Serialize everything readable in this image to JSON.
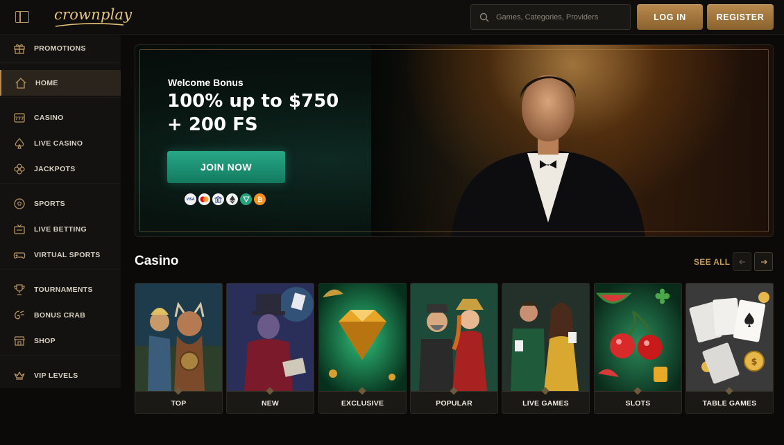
{
  "header": {
    "logo_text": "crownplay",
    "search_placeholder": "Games, Categories, Providers",
    "login_label": "LOG IN",
    "register_label": "REGISTER"
  },
  "sidebar": {
    "items": [
      {
        "label": "PROMOTIONS",
        "icon": "gift-icon"
      },
      {
        "label": "HOME",
        "icon": "home-icon",
        "active": true
      },
      {
        "label": "CASINO",
        "icon": "slot-777-icon"
      },
      {
        "label": "LIVE CASINO",
        "icon": "spade-icon"
      },
      {
        "label": "JACKPOTS",
        "icon": "clover-icon"
      },
      {
        "label": "SPORTS",
        "icon": "soccer-ball-icon"
      },
      {
        "label": "LIVE BETTING",
        "icon": "live-tv-icon"
      },
      {
        "label": "VIRTUAL SPORTS",
        "icon": "gamepad-icon"
      },
      {
        "label": "TOURNAMENTS",
        "icon": "trophy-icon"
      },
      {
        "label": "BONUS CRAB",
        "icon": "claw-icon"
      },
      {
        "label": "SHOP",
        "icon": "shop-icon"
      },
      {
        "label": "VIP LEVELS",
        "icon": "crown-icon"
      }
    ]
  },
  "banner": {
    "eyebrow": "Welcome Bonus",
    "headline_line1": "100% up to $750",
    "headline_line2": "+ 200 FS",
    "cta": "JOIN NOW",
    "payments": [
      "VISA",
      "MC",
      "BANK",
      "ETH",
      "USDT",
      "BTC"
    ]
  },
  "casino": {
    "title": "Casino",
    "see_all": "SEE ALL",
    "tiles": [
      {
        "label": "TOP"
      },
      {
        "label": "NEW"
      },
      {
        "label": "EXCLUSIVE"
      },
      {
        "label": "POPULAR"
      },
      {
        "label": "LIVE GAMES"
      },
      {
        "label": "SLOTS"
      },
      {
        "label": "TABLE GAMES"
      }
    ]
  },
  "colors": {
    "accent_gold": "#b88a4e",
    "cta_green": "#1f9a7a",
    "background": "#0b0a09"
  }
}
